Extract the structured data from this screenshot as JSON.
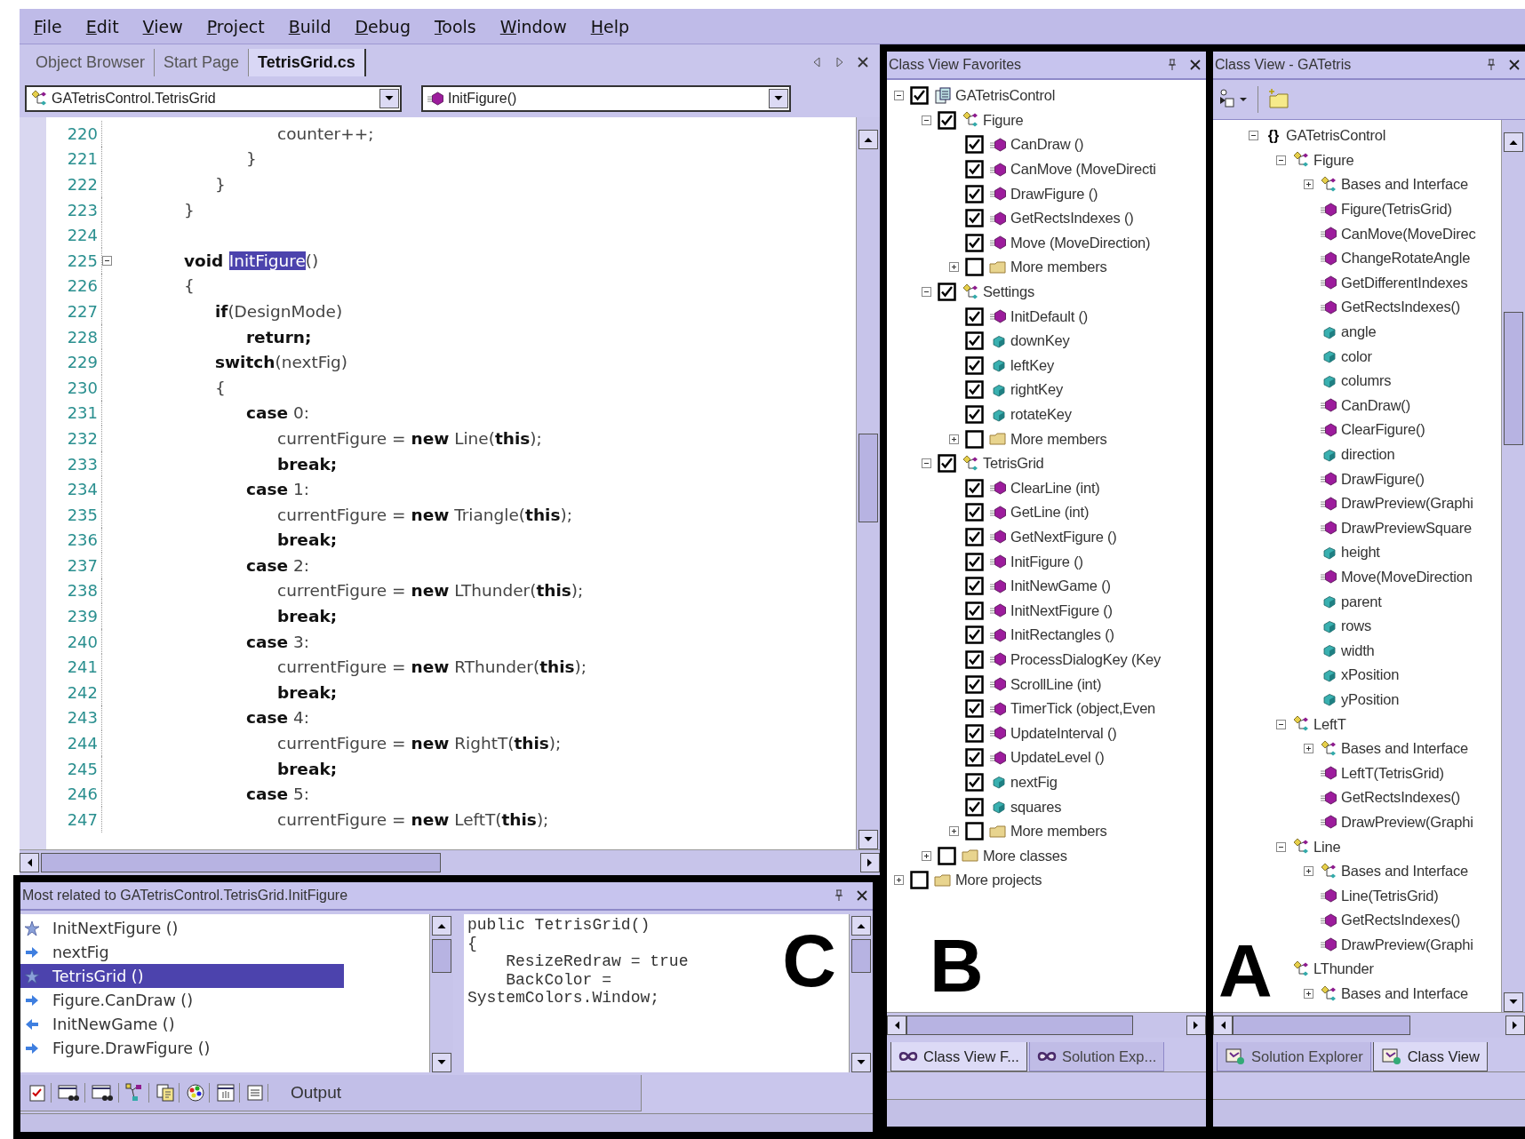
{
  "menu_bar": [
    {
      "label": "File"
    },
    {
      "label": "Edit"
    },
    {
      "label": "View"
    },
    {
      "label": "Project"
    },
    {
      "label": "Build"
    },
    {
      "label": "Debug"
    },
    {
      "label": "Tools"
    },
    {
      "label": "Window"
    },
    {
      "label": "Help"
    }
  ],
  "editor": {
    "tabs": [
      {
        "label": "Object Browser",
        "selected": false
      },
      {
        "label": "Start Page",
        "selected": false
      },
      {
        "label": "TetrisGrid.cs",
        "selected": true
      }
    ],
    "type_combo": {
      "value": "GATetrisControl.TetrisGrid"
    },
    "member_combo": {
      "value": "InitFigure()"
    },
    "code_lines": [
      {
        "number": "220",
        "segments": [
          {
            "text": "\t\t\t\t\tcounter++;",
            "kind": "plain"
          }
        ]
      },
      {
        "number": "221",
        "segments": [
          {
            "text": "\t\t\t\t}",
            "kind": "plain"
          }
        ]
      },
      {
        "number": "222",
        "segments": [
          {
            "text": "\t\t\t}",
            "kind": "plain"
          }
        ]
      },
      {
        "number": "223",
        "segments": [
          {
            "text": "\t\t}",
            "kind": "plain"
          }
        ]
      },
      {
        "number": "224"
      },
      {
        "number": "225",
        "expanded": true,
        "segments": [
          {
            "text": "\t\tvoid ",
            "kind": "keyword"
          },
          {
            "text": "InitFigure",
            "kind": "selected"
          },
          {
            "text": "()",
            "kind": "plain"
          }
        ]
      },
      {
        "number": "226",
        "segments": [
          {
            "text": "\t\t{",
            "kind": "plain"
          }
        ]
      },
      {
        "number": "227",
        "segments": [
          {
            "text": "\t\t\tif",
            "kind": "keyword"
          },
          {
            "text": "(DesignMode)",
            "kind": "plain"
          }
        ]
      },
      {
        "number": "228",
        "segments": [
          {
            "text": "\t\t\t\treturn;",
            "kind": "keyword"
          }
        ]
      },
      {
        "number": "229",
        "segments": [
          {
            "text": "\t\t\tswitch",
            "kind": "keyword"
          },
          {
            "text": "(nextFig)",
            "kind": "plain"
          }
        ]
      },
      {
        "number": "230",
        "segments": [
          {
            "text": "\t\t\t{",
            "kind": "plain"
          }
        ]
      },
      {
        "number": "231",
        "segments": [
          {
            "text": "\t\t\t\tcase",
            "kind": "keyword"
          },
          {
            "text": " 0:",
            "kind": "plain"
          }
        ]
      },
      {
        "number": "232",
        "segments": [
          {
            "text": "\t\t\t\t\tcurrentFigure = ",
            "kind": "plain"
          },
          {
            "text": "new",
            "kind": "keyword"
          },
          {
            "text": " Line(",
            "kind": "plain"
          },
          {
            "text": "this",
            "kind": "keyword"
          },
          {
            "text": ");",
            "kind": "plain"
          }
        ]
      },
      {
        "number": "233",
        "segments": [
          {
            "text": "\t\t\t\t\tbreak;",
            "kind": "keyword"
          }
        ]
      },
      {
        "number": "234",
        "segments": [
          {
            "text": "\t\t\t\tcase",
            "kind": "keyword"
          },
          {
            "text": " 1:",
            "kind": "plain"
          }
        ]
      },
      {
        "number": "235",
        "segments": [
          {
            "text": "\t\t\t\t\tcurrentFigure = ",
            "kind": "plain"
          },
          {
            "text": "new",
            "kind": "keyword"
          },
          {
            "text": " Triangle(",
            "kind": "plain"
          },
          {
            "text": "this",
            "kind": "keyword"
          },
          {
            "text": ");",
            "kind": "plain"
          }
        ]
      },
      {
        "number": "236",
        "segments": [
          {
            "text": "\t\t\t\t\tbreak;",
            "kind": "keyword"
          }
        ]
      },
      {
        "number": "237",
        "segments": [
          {
            "text": "\t\t\t\tcase",
            "kind": "keyword"
          },
          {
            "text": " 2:",
            "kind": "plain"
          }
        ]
      },
      {
        "number": "238",
        "segments": [
          {
            "text": "\t\t\t\t\tcurrentFigure = ",
            "kind": "plain"
          },
          {
            "text": "new",
            "kind": "keyword"
          },
          {
            "text": " LThunder(",
            "kind": "plain"
          },
          {
            "text": "this",
            "kind": "keyword"
          },
          {
            "text": ");",
            "kind": "plain"
          }
        ]
      },
      {
        "number": "239",
        "segments": [
          {
            "text": "\t\t\t\t\tbreak;",
            "kind": "keyword"
          }
        ]
      },
      {
        "number": "240",
        "segments": [
          {
            "text": "\t\t\t\tcase",
            "kind": "keyword"
          },
          {
            "text": " 3:",
            "kind": "plain"
          }
        ]
      },
      {
        "number": "241",
        "segments": [
          {
            "text": "\t\t\t\t\tcurrentFigure = ",
            "kind": "plain"
          },
          {
            "text": "new",
            "kind": "keyword"
          },
          {
            "text": " RThunder(",
            "kind": "plain"
          },
          {
            "text": "this",
            "kind": "keyword"
          },
          {
            "text": ");",
            "kind": "plain"
          }
        ]
      },
      {
        "number": "242",
        "segments": [
          {
            "text": "\t\t\t\t\tbreak;",
            "kind": "keyword"
          }
        ]
      },
      {
        "number": "243",
        "segments": [
          {
            "text": "\t\t\t\tcase",
            "kind": "keyword"
          },
          {
            "text": " 4:",
            "kind": "plain"
          }
        ]
      },
      {
        "number": "244",
        "segments": [
          {
            "text": "\t\t\t\t\tcurrentFigure = ",
            "kind": "plain"
          },
          {
            "text": "new",
            "kind": "keyword"
          },
          {
            "text": " RightT(",
            "kind": "plain"
          },
          {
            "text": "this",
            "kind": "keyword"
          },
          {
            "text": ");",
            "kind": "plain"
          }
        ]
      },
      {
        "number": "245",
        "segments": [
          {
            "text": "\t\t\t\t\tbreak;",
            "kind": "keyword"
          }
        ]
      },
      {
        "number": "246",
        "segments": [
          {
            "text": "\t\t\t\tcase",
            "kind": "keyword"
          },
          {
            "text": " 5:",
            "kind": "plain"
          }
        ]
      },
      {
        "number": "247",
        "segments": [
          {
            "text": "\t\t\t\t\tcurrentFigure = ",
            "kind": "plain"
          },
          {
            "text": "new",
            "kind": "keyword"
          },
          {
            "text": " LeftT(",
            "kind": "plain"
          },
          {
            "text": "this",
            "kind": "keyword"
          },
          {
            "text": ");",
            "kind": "plain"
          }
        ]
      }
    ]
  },
  "related_panel": {
    "title": "Most related to GATetrisControl.TetrisGrid.InitFigure",
    "panel_label": "C",
    "items": [
      {
        "label": "InitNextFigure ()",
        "kind": "star",
        "selected": false
      },
      {
        "label": "nextFig",
        "kind": "arrow-right",
        "selected": false
      },
      {
        "label": "TetrisGrid ()",
        "kind": "star",
        "selected": true
      },
      {
        "label": "Figure.CanDraw ()",
        "kind": "arrow-right",
        "selected": false
      },
      {
        "label": "InitNewGame ()",
        "kind": "arrow-left",
        "selected": false
      },
      {
        "label": "Figure.DrawFigure ()",
        "kind": "arrow-right",
        "selected": false
      }
    ],
    "preview_lines": [
      "public TetrisGrid()",
      "{",
      "    ResizeRedraw = true",
      "    BackColor =",
      "SystemColors.Window;"
    ],
    "output_tab": "Output"
  },
  "class_view_favorites": {
    "title": "Class View Favorites",
    "panel_label": "B",
    "tree": [
      {
        "label": "GATetrisControl",
        "kind": "project",
        "checked": true,
        "expanded": true,
        "children": [
          {
            "label": "Figure",
            "kind": "class",
            "checked": true,
            "expanded": true,
            "children": [
              {
                "label": "CanDraw ()",
                "kind": "method",
                "checked": true
              },
              {
                "label": "CanMove (MoveDirecti",
                "kind": "method",
                "checked": true
              },
              {
                "label": "DrawFigure ()",
                "kind": "method",
                "checked": true
              },
              {
                "label": "GetRectsIndexes ()",
                "kind": "method",
                "checked": true
              },
              {
                "label": "Move (MoveDirection)",
                "kind": "method",
                "checked": true
              },
              {
                "label": "More members",
                "kind": "folder",
                "checked": false,
                "expanded": false
              }
            ]
          },
          {
            "label": "Settings",
            "kind": "class",
            "checked": true,
            "expanded": true,
            "children": [
              {
                "label": "InitDefault ()",
                "kind": "method",
                "checked": true
              },
              {
                "label": "downKey",
                "kind": "field",
                "checked": true
              },
              {
                "label": "leftKey",
                "kind": "field",
                "checked": true
              },
              {
                "label": "rightKey",
                "kind": "field",
                "checked": true
              },
              {
                "label": "rotateKey",
                "kind": "field",
                "checked": true
              },
              {
                "label": "More members",
                "kind": "folder",
                "checked": false,
                "expanded": false
              }
            ]
          },
          {
            "label": "TetrisGrid",
            "kind": "class",
            "checked": true,
            "expanded": true,
            "children": [
              {
                "label": "ClearLine (int)",
                "kind": "method",
                "checked": true
              },
              {
                "label": "GetLine (int)",
                "kind": "method",
                "checked": true
              },
              {
                "label": "GetNextFigure ()",
                "kind": "method",
                "checked": true
              },
              {
                "label": "InitFigure ()",
                "kind": "method",
                "checked": true
              },
              {
                "label": "InitNewGame ()",
                "kind": "method",
                "checked": true
              },
              {
                "label": "InitNextFigure ()",
                "kind": "method",
                "checked": true
              },
              {
                "label": "InitRectangles ()",
                "kind": "method",
                "checked": true
              },
              {
                "label": "ProcessDialogKey (Key",
                "kind": "method",
                "checked": true
              },
              {
                "label": "ScrollLine (int)",
                "kind": "method",
                "checked": true
              },
              {
                "label": "TimerTick (object,Even",
                "kind": "method",
                "checked": true
              },
              {
                "label": "UpdateInterval ()",
                "kind": "method",
                "checked": true
              },
              {
                "label": "UpdateLevel ()",
                "kind": "method",
                "checked": true
              },
              {
                "label": "nextFig",
                "kind": "field",
                "checked": true
              },
              {
                "label": "squares",
                "kind": "field",
                "checked": true
              },
              {
                "label": "More members",
                "kind": "folder",
                "checked": false,
                "expanded": false
              }
            ]
          },
          {
            "label": "More classes",
            "kind": "folder",
            "checked": false,
            "expanded": false
          }
        ]
      },
      {
        "label": "More projects",
        "kind": "folder",
        "checked": false,
        "expanded": false
      }
    ],
    "tabs": [
      {
        "label": "Class View F...",
        "selected": true
      },
      {
        "label": "Solution Exp...",
        "selected": false
      }
    ]
  },
  "class_view": {
    "title": "Class View - GATetris",
    "panel_label": "A",
    "tree": [
      {
        "label": "GATetrisControl",
        "kind": "namespace",
        "icon_text": "{}",
        "expanded": true,
        "children": [
          {
            "label": "Figure",
            "kind": "class",
            "expanded": true,
            "children": [
              {
                "label": "Bases and Interface",
                "kind": "bases",
                "expanded": false
              },
              {
                "label": "Figure(TetrisGrid)",
                "kind": "method"
              },
              {
                "label": "CanMove(MoveDirec",
                "kind": "method"
              },
              {
                "label": "ChangeRotateAngle",
                "kind": "method"
              },
              {
                "label": "GetDifferentIndexes",
                "kind": "method"
              },
              {
                "label": "GetRectsIndexes()",
                "kind": "method"
              },
              {
                "label": "angle",
                "kind": "field"
              },
              {
                "label": "color",
                "kind": "field"
              },
              {
                "label": "columrs",
                "kind": "field"
              },
              {
                "label": "CanDraw()",
                "kind": "method"
              },
              {
                "label": "ClearFigure()",
                "kind": "method"
              },
              {
                "label": "direction",
                "kind": "field"
              },
              {
                "label": "DrawFigure()",
                "kind": "method"
              },
              {
                "label": "DrawPreview(Graphi",
                "kind": "method"
              },
              {
                "label": "DrawPreviewSquare",
                "kind": "method"
              },
              {
                "label": "height",
                "kind": "field"
              },
              {
                "label": "Move(MoveDirection",
                "kind": "method"
              },
              {
                "label": "parent",
                "kind": "field"
              },
              {
                "label": "rows",
                "kind": "field"
              },
              {
                "label": "width",
                "kind": "field"
              },
              {
                "label": "xPosition",
                "kind": "field"
              },
              {
                "label": "yPosition",
                "kind": "field"
              }
            ]
          },
          {
            "label": "LeftT",
            "kind": "class",
            "expanded": true,
            "children": [
              {
                "label": "Bases and Interface",
                "kind": "bases",
                "expanded": false
              },
              {
                "label": "LeftT(TetrisGrid)",
                "kind": "method"
              },
              {
                "label": "GetRectsIndexes()",
                "kind": "method"
              },
              {
                "label": "DrawPreview(Graphi",
                "kind": "method"
              }
            ]
          },
          {
            "label": "Line",
            "kind": "class",
            "expanded": true,
            "children": [
              {
                "label": "Bases and Interface",
                "kind": "bases",
                "expanded": false
              },
              {
                "label": "Line(TetrisGrid)",
                "kind": "method"
              },
              {
                "label": "GetRectsIndexes()",
                "kind": "method"
              },
              {
                "label": "DrawPreview(Graphi",
                "kind": "method"
              }
            ]
          },
          {
            "label": "LThunder",
            "kind": "class",
            "children": [
              {
                "label": "Bases and Interface",
                "kind": "bases",
                "expanded": false
              }
            ]
          }
        ]
      }
    ],
    "tabs": [
      {
        "label": "Solution Explorer",
        "selected": false
      },
      {
        "label": "Class View",
        "selected": true
      }
    ]
  }
}
